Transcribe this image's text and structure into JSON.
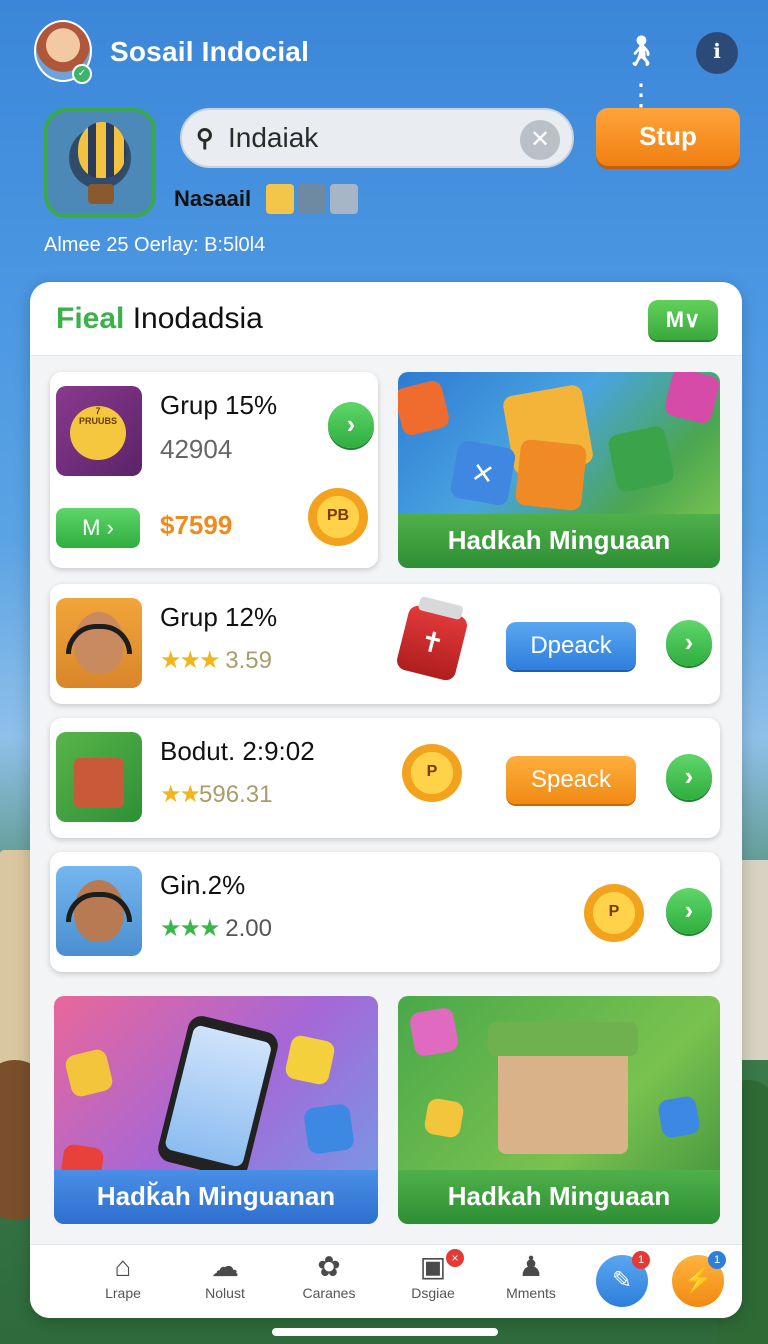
{
  "header": {
    "app_title": "Sosail Indocial",
    "avatar_badge": "✓",
    "icons": {
      "profile": "walk-icon",
      "info": "info-icon"
    }
  },
  "profile": {
    "search_value": "Indaiak",
    "setup_label": "Stup",
    "user_name": "Nasaail",
    "status_line": "Almee 25 Oerlay: B:5l0l4"
  },
  "panel": {
    "title_accent": "Fieal",
    "title_rest": " Inodadsia",
    "more_label": "M∨"
  },
  "featured": {
    "title": "Grup 15%",
    "sub": "42904",
    "badge_text": "7",
    "badge_sub": "PRUUBS",
    "mini_label": "M ›",
    "price": "$7599",
    "coin_text": "PB",
    "arrow": "›"
  },
  "promo_top": {
    "label": "Hadkah Minguaan",
    "tile_text": "×"
  },
  "rows": [
    {
      "title": "Grup 12%",
      "stars": "★★★",
      "value": " 3.59",
      "action": "Dpeack",
      "action_color": "#2e7fdc",
      "icon": "potion-icon",
      "potion_text": "✝"
    },
    {
      "title": "Bodut. 2:9:02",
      "stars": "★★",
      "value": "596.31",
      "action": "Speack",
      "action_color": "#f08a14",
      "icon": "coin-icon",
      "coin_text": "P"
    },
    {
      "title": "Gin.2%",
      "stars": "★★★",
      "value": " 2.00",
      "icon": "coin-icon",
      "coin_text": "P"
    }
  ],
  "promos_bottom": [
    {
      "label": "Hadk̆ah Minguanan"
    },
    {
      "label": "Hadkah Minguaan"
    }
  ],
  "nav": [
    {
      "label": "Lrape",
      "icon": "home-icon"
    },
    {
      "label": "Nolust",
      "icon": "cloud-icon"
    },
    {
      "label": "Caranes",
      "icon": "pinwheel-icon"
    },
    {
      "label": "Dsgiae",
      "icon": "image-icon",
      "badge": "×"
    },
    {
      "label": "Mments",
      "icon": "people-icon"
    }
  ],
  "fabs": [
    {
      "icon": "pencil-icon",
      "badge": "1"
    },
    {
      "icon": "lightning-icon",
      "badge": "1"
    }
  ]
}
